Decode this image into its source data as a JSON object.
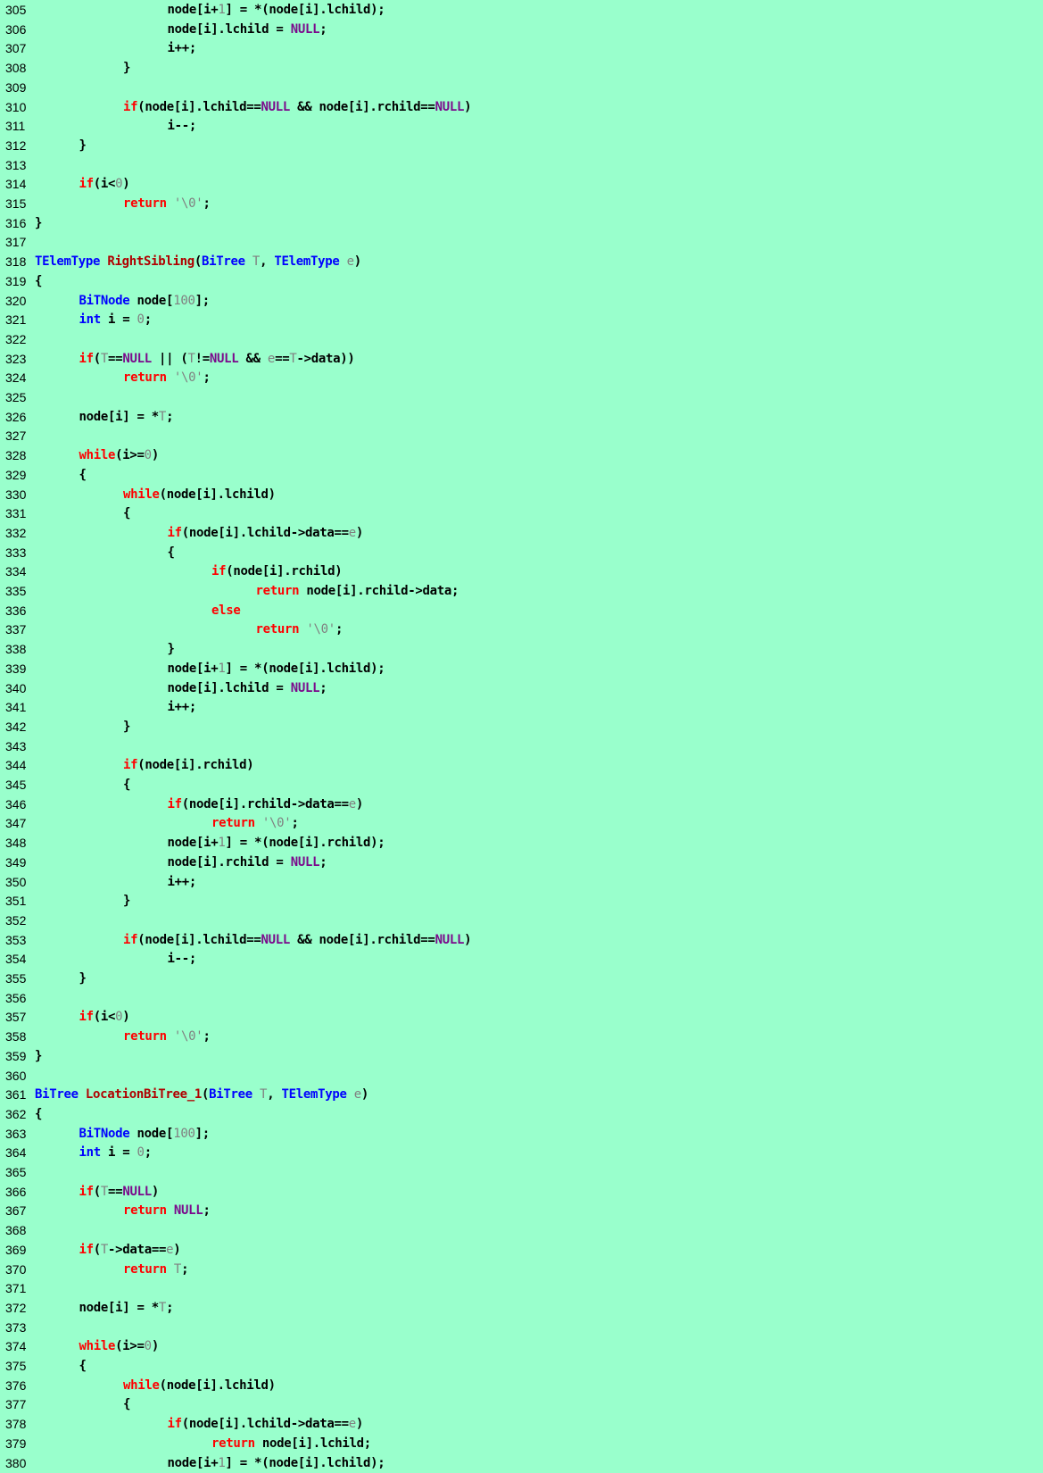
{
  "theme": {
    "background": "#99ffcc",
    "keyword": "#ff0000",
    "type": "#0000ff",
    "constant": "#7b0a8c",
    "number": "#808080",
    "parameter": "#808080",
    "function": "#b00000",
    "plain": "#000000"
  },
  "lines": [
    {
      "n": "305",
      "indent": 3,
      "tokens": [
        [
          "p",
          "node[i+"
        ],
        [
          "num",
          "1"
        ],
        [
          "p",
          "] = *(node[i].lchild);"
        ]
      ]
    },
    {
      "n": "306",
      "indent": 3,
      "tokens": [
        [
          "p",
          "node[i].lchild = "
        ],
        [
          "const",
          "NULL"
        ],
        [
          "p",
          ";"
        ]
      ]
    },
    {
      "n": "307",
      "indent": 3,
      "tokens": [
        [
          "p",
          "i++;"
        ]
      ]
    },
    {
      "n": "308",
      "indent": 2,
      "tokens": [
        [
          "p",
          "}"
        ]
      ]
    },
    {
      "n": "309",
      "indent": 0,
      "tokens": []
    },
    {
      "n": "310",
      "indent": 2,
      "tokens": [
        [
          "kw",
          "if"
        ],
        [
          "p",
          "(node[i].lchild=="
        ],
        [
          "const",
          "NULL"
        ],
        [
          "p",
          " && node[i].rchild=="
        ],
        [
          "const",
          "NULL"
        ],
        [
          "p",
          ")"
        ]
      ]
    },
    {
      "n": "311",
      "indent": 3,
      "tokens": [
        [
          "p",
          "i--;"
        ]
      ]
    },
    {
      "n": "312",
      "indent": 1,
      "tokens": [
        [
          "p",
          "}"
        ]
      ]
    },
    {
      "n": "313",
      "indent": 0,
      "tokens": []
    },
    {
      "n": "314",
      "indent": 1,
      "tokens": [
        [
          "kw",
          "if"
        ],
        [
          "p",
          "(i<"
        ],
        [
          "num",
          "0"
        ],
        [
          "p",
          ")"
        ]
      ]
    },
    {
      "n": "315",
      "indent": 2,
      "tokens": [
        [
          "kw",
          "return"
        ],
        [
          "p",
          " "
        ],
        [
          "str",
          "'\\0'"
        ],
        [
          "p",
          ";"
        ]
      ]
    },
    {
      "n": "316",
      "indent": 0,
      "tokens": [
        [
          "p",
          "}"
        ]
      ]
    },
    {
      "n": "317",
      "indent": 0,
      "tokens": []
    },
    {
      "n": "318",
      "indent": 0,
      "tokens": [
        [
          "type",
          "TElemType"
        ],
        [
          "p",
          " "
        ],
        [
          "func",
          "RightSibling"
        ],
        [
          "p",
          "("
        ],
        [
          "type",
          "BiTree"
        ],
        [
          "p",
          " "
        ],
        [
          "param",
          "T"
        ],
        [
          "p",
          ", "
        ],
        [
          "type",
          "TElemType"
        ],
        [
          "p",
          " "
        ],
        [
          "param",
          "e"
        ],
        [
          "p",
          ")"
        ]
      ]
    },
    {
      "n": "319",
      "indent": 0,
      "tokens": [
        [
          "p",
          "{"
        ]
      ]
    },
    {
      "n": "320",
      "indent": 1,
      "tokens": [
        [
          "type",
          "BiTNode"
        ],
        [
          "p",
          " node["
        ],
        [
          "num",
          "100"
        ],
        [
          "p",
          "];"
        ]
      ]
    },
    {
      "n": "321",
      "indent": 1,
      "tokens": [
        [
          "type",
          "int"
        ],
        [
          "p",
          " i = "
        ],
        [
          "num",
          "0"
        ],
        [
          "p",
          ";"
        ]
      ]
    },
    {
      "n": "322",
      "indent": 0,
      "tokens": []
    },
    {
      "n": "323",
      "indent": 1,
      "tokens": [
        [
          "kw",
          "if"
        ],
        [
          "p",
          "("
        ],
        [
          "param",
          "T"
        ],
        [
          "p",
          "=="
        ],
        [
          "const",
          "NULL"
        ],
        [
          "p",
          " || ("
        ],
        [
          "param",
          "T"
        ],
        [
          "p",
          "!="
        ],
        [
          "const",
          "NULL"
        ],
        [
          "p",
          " && "
        ],
        [
          "param",
          "e"
        ],
        [
          "p",
          "=="
        ],
        [
          "param",
          "T"
        ],
        [
          "p",
          "->data))"
        ]
      ]
    },
    {
      "n": "324",
      "indent": 2,
      "tokens": [
        [
          "kw",
          "return"
        ],
        [
          "p",
          " "
        ],
        [
          "str",
          "'\\0'"
        ],
        [
          "p",
          ";"
        ]
      ]
    },
    {
      "n": "325",
      "indent": 0,
      "tokens": []
    },
    {
      "n": "326",
      "indent": 1,
      "tokens": [
        [
          "p",
          "node[i] = *"
        ],
        [
          "param",
          "T"
        ],
        [
          "p",
          ";"
        ]
      ]
    },
    {
      "n": "327",
      "indent": 0,
      "tokens": []
    },
    {
      "n": "328",
      "indent": 1,
      "tokens": [
        [
          "kw",
          "while"
        ],
        [
          "p",
          "(i>="
        ],
        [
          "num",
          "0"
        ],
        [
          "p",
          ")"
        ]
      ]
    },
    {
      "n": "329",
      "indent": 1,
      "tokens": [
        [
          "p",
          "{"
        ]
      ]
    },
    {
      "n": "330",
      "indent": 2,
      "tokens": [
        [
          "kw",
          "while"
        ],
        [
          "p",
          "(node[i].lchild)"
        ]
      ]
    },
    {
      "n": "331",
      "indent": 2,
      "tokens": [
        [
          "p",
          "{"
        ]
      ]
    },
    {
      "n": "332",
      "indent": 3,
      "tokens": [
        [
          "kw",
          "if"
        ],
        [
          "p",
          "(node[i].lchild->data=="
        ],
        [
          "param",
          "e"
        ],
        [
          "p",
          ")"
        ]
      ]
    },
    {
      "n": "333",
      "indent": 3,
      "tokens": [
        [
          "p",
          "{"
        ]
      ]
    },
    {
      "n": "334",
      "indent": 4,
      "tokens": [
        [
          "kw",
          "if"
        ],
        [
          "p",
          "(node[i].rchild)"
        ]
      ]
    },
    {
      "n": "335",
      "indent": 5,
      "tokens": [
        [
          "kw",
          "return"
        ],
        [
          "p",
          " node[i].rchild->data;"
        ]
      ]
    },
    {
      "n": "336",
      "indent": 4,
      "tokens": [
        [
          "kw",
          "else"
        ]
      ]
    },
    {
      "n": "337",
      "indent": 5,
      "tokens": [
        [
          "kw",
          "return"
        ],
        [
          "p",
          " "
        ],
        [
          "str",
          "'\\0'"
        ],
        [
          "p",
          ";"
        ]
      ]
    },
    {
      "n": "338",
      "indent": 3,
      "tokens": [
        [
          "p",
          "}"
        ]
      ]
    },
    {
      "n": "339",
      "indent": 3,
      "tokens": [
        [
          "p",
          "node[i+"
        ],
        [
          "num",
          "1"
        ],
        [
          "p",
          "] = *(node[i].lchild);"
        ]
      ]
    },
    {
      "n": "340",
      "indent": 3,
      "tokens": [
        [
          "p",
          "node[i].lchild = "
        ],
        [
          "const",
          "NULL"
        ],
        [
          "p",
          ";"
        ]
      ]
    },
    {
      "n": "341",
      "indent": 3,
      "tokens": [
        [
          "p",
          "i++;"
        ]
      ]
    },
    {
      "n": "342",
      "indent": 2,
      "tokens": [
        [
          "p",
          "}"
        ]
      ]
    },
    {
      "n": "343",
      "indent": 0,
      "tokens": []
    },
    {
      "n": "344",
      "indent": 2,
      "tokens": [
        [
          "kw",
          "if"
        ],
        [
          "p",
          "(node[i].rchild)"
        ]
      ]
    },
    {
      "n": "345",
      "indent": 2,
      "tokens": [
        [
          "p",
          "{"
        ]
      ]
    },
    {
      "n": "346",
      "indent": 3,
      "tokens": [
        [
          "kw",
          "if"
        ],
        [
          "p",
          "(node[i].rchild->data=="
        ],
        [
          "param",
          "e"
        ],
        [
          "p",
          ")"
        ]
      ]
    },
    {
      "n": "347",
      "indent": 4,
      "tokens": [
        [
          "kw",
          "return"
        ],
        [
          "p",
          " "
        ],
        [
          "str",
          "'\\0'"
        ],
        [
          "p",
          ";"
        ]
      ]
    },
    {
      "n": "348",
      "indent": 3,
      "tokens": [
        [
          "p",
          "node[i+"
        ],
        [
          "num",
          "1"
        ],
        [
          "p",
          "] = *(node[i].rchild);"
        ]
      ]
    },
    {
      "n": "349",
      "indent": 3,
      "tokens": [
        [
          "p",
          "node[i].rchild = "
        ],
        [
          "const",
          "NULL"
        ],
        [
          "p",
          ";"
        ]
      ]
    },
    {
      "n": "350",
      "indent": 3,
      "tokens": [
        [
          "p",
          "i++;"
        ]
      ]
    },
    {
      "n": "351",
      "indent": 2,
      "tokens": [
        [
          "p",
          "}"
        ]
      ]
    },
    {
      "n": "352",
      "indent": 0,
      "tokens": []
    },
    {
      "n": "353",
      "indent": 2,
      "tokens": [
        [
          "kw",
          "if"
        ],
        [
          "p",
          "(node[i].lchild=="
        ],
        [
          "const",
          "NULL"
        ],
        [
          "p",
          " && node[i].rchild=="
        ],
        [
          "const",
          "NULL"
        ],
        [
          "p",
          ")"
        ]
      ]
    },
    {
      "n": "354",
      "indent": 3,
      "tokens": [
        [
          "p",
          "i--;"
        ]
      ]
    },
    {
      "n": "355",
      "indent": 1,
      "tokens": [
        [
          "p",
          "}"
        ]
      ]
    },
    {
      "n": "356",
      "indent": 0,
      "tokens": []
    },
    {
      "n": "357",
      "indent": 1,
      "tokens": [
        [
          "kw",
          "if"
        ],
        [
          "p",
          "(i<"
        ],
        [
          "num",
          "0"
        ],
        [
          "p",
          ")"
        ]
      ]
    },
    {
      "n": "358",
      "indent": 2,
      "tokens": [
        [
          "kw",
          "return"
        ],
        [
          "p",
          " "
        ],
        [
          "str",
          "'\\0'"
        ],
        [
          "p",
          ";"
        ]
      ]
    },
    {
      "n": "359",
      "indent": 0,
      "tokens": [
        [
          "p",
          "}"
        ]
      ]
    },
    {
      "n": "360",
      "indent": 0,
      "tokens": []
    },
    {
      "n": "361",
      "indent": 0,
      "tokens": [
        [
          "type",
          "BiTree"
        ],
        [
          "p",
          " "
        ],
        [
          "func",
          "LocationBiTree_1"
        ],
        [
          "p",
          "("
        ],
        [
          "type",
          "BiTree"
        ],
        [
          "p",
          " "
        ],
        [
          "param",
          "T"
        ],
        [
          "p",
          ", "
        ],
        [
          "type",
          "TElemType"
        ],
        [
          "p",
          " "
        ],
        [
          "param",
          "e"
        ],
        [
          "p",
          ")"
        ]
      ]
    },
    {
      "n": "362",
      "indent": 0,
      "tokens": [
        [
          "p",
          "{"
        ]
      ]
    },
    {
      "n": "363",
      "indent": 1,
      "tokens": [
        [
          "type",
          "BiTNode"
        ],
        [
          "p",
          " node["
        ],
        [
          "num",
          "100"
        ],
        [
          "p",
          "];"
        ]
      ]
    },
    {
      "n": "364",
      "indent": 1,
      "tokens": [
        [
          "type",
          "int"
        ],
        [
          "p",
          " i = "
        ],
        [
          "num",
          "0"
        ],
        [
          "p",
          ";"
        ]
      ]
    },
    {
      "n": "365",
      "indent": 0,
      "tokens": []
    },
    {
      "n": "366",
      "indent": 1,
      "tokens": [
        [
          "kw",
          "if"
        ],
        [
          "p",
          "("
        ],
        [
          "param",
          "T"
        ],
        [
          "p",
          "=="
        ],
        [
          "const",
          "NULL"
        ],
        [
          "p",
          ")"
        ]
      ]
    },
    {
      "n": "367",
      "indent": 2,
      "tokens": [
        [
          "kw",
          "return"
        ],
        [
          "p",
          " "
        ],
        [
          "const",
          "NULL"
        ],
        [
          "p",
          ";"
        ]
      ]
    },
    {
      "n": "368",
      "indent": 0,
      "tokens": []
    },
    {
      "n": "369",
      "indent": 1,
      "tokens": [
        [
          "kw",
          "if"
        ],
        [
          "p",
          "("
        ],
        [
          "param",
          "T"
        ],
        [
          "p",
          "->data=="
        ],
        [
          "param",
          "e"
        ],
        [
          "p",
          ")"
        ]
      ]
    },
    {
      "n": "370",
      "indent": 2,
      "tokens": [
        [
          "kw",
          "return"
        ],
        [
          "p",
          " "
        ],
        [
          "param",
          "T"
        ],
        [
          "p",
          ";"
        ]
      ]
    },
    {
      "n": "371",
      "indent": 0,
      "tokens": []
    },
    {
      "n": "372",
      "indent": 1,
      "tokens": [
        [
          "p",
          "node[i] = *"
        ],
        [
          "param",
          "T"
        ],
        [
          "p",
          ";"
        ]
      ]
    },
    {
      "n": "373",
      "indent": 0,
      "tokens": []
    },
    {
      "n": "374",
      "indent": 1,
      "tokens": [
        [
          "kw",
          "while"
        ],
        [
          "p",
          "(i>="
        ],
        [
          "num",
          "0"
        ],
        [
          "p",
          ")"
        ]
      ]
    },
    {
      "n": "375",
      "indent": 1,
      "tokens": [
        [
          "p",
          "{"
        ]
      ]
    },
    {
      "n": "376",
      "indent": 2,
      "tokens": [
        [
          "kw",
          "while"
        ],
        [
          "p",
          "(node[i].lchild)"
        ]
      ]
    },
    {
      "n": "377",
      "indent": 2,
      "tokens": [
        [
          "p",
          "{"
        ]
      ]
    },
    {
      "n": "378",
      "indent": 3,
      "tokens": [
        [
          "kw",
          "if"
        ],
        [
          "p",
          "(node[i].lchild->data=="
        ],
        [
          "param",
          "e"
        ],
        [
          "p",
          ")"
        ]
      ]
    },
    {
      "n": "379",
      "indent": 4,
      "tokens": [
        [
          "kw",
          "return"
        ],
        [
          "p",
          " node[i].lchild;"
        ]
      ]
    },
    {
      "n": "380",
      "indent": 3,
      "tokens": [
        [
          "p",
          "node[i+"
        ],
        [
          "num",
          "1"
        ],
        [
          "p",
          "] = *(node[i].lchild);"
        ]
      ]
    }
  ]
}
